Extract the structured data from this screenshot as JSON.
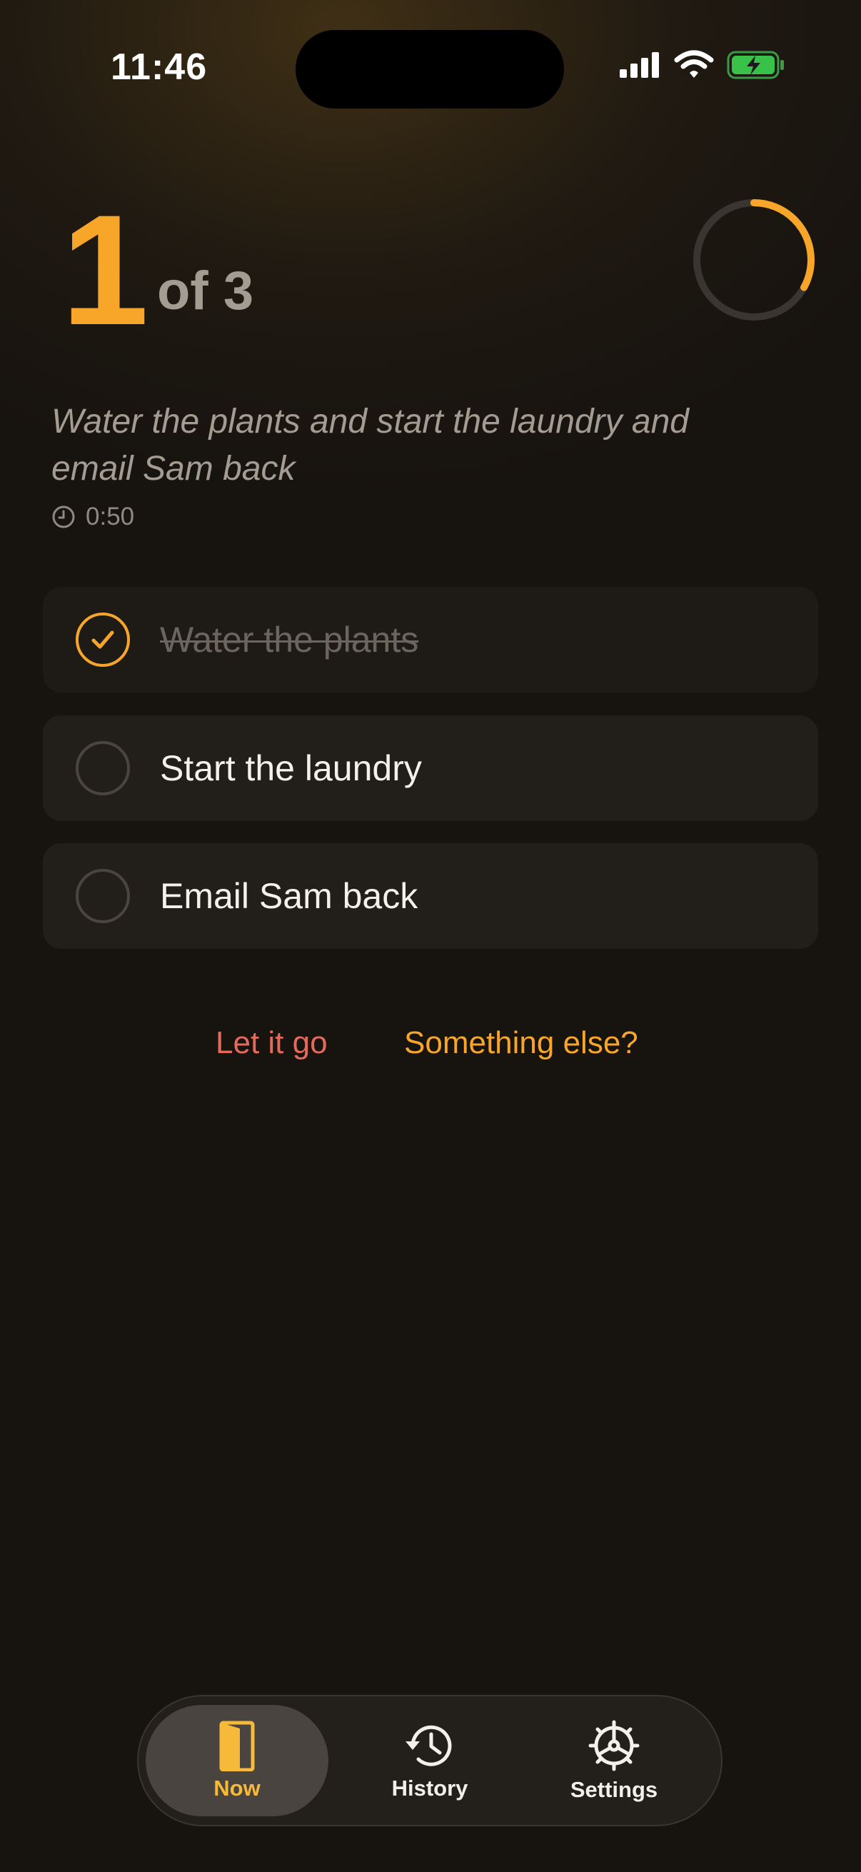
{
  "status_bar": {
    "time": "11:46"
  },
  "counter": {
    "current": "1",
    "total_label": "of 3",
    "progress": 0.33
  },
  "prompt": {
    "text": "Water the plants and start the laundry and email Sam back",
    "elapsed": "0:50"
  },
  "tasks": [
    {
      "label": "Water the plants",
      "done": true
    },
    {
      "label": "Start the laundry",
      "done": false
    },
    {
      "label": "Email Sam back",
      "done": false
    }
  ],
  "actions": {
    "let_go": "Let it go",
    "something_else": "Something else?"
  },
  "tabbar": {
    "items": [
      {
        "label": "Now",
        "icon": "door-icon",
        "active": true
      },
      {
        "label": "History",
        "icon": "history-clock-icon",
        "active": false
      },
      {
        "label": "Settings",
        "icon": "gear-icon",
        "active": false
      }
    ]
  },
  "colors": {
    "accent": "#f7a62a",
    "destructive": "#e56a5c",
    "background": "#17130f",
    "card": "#221e1a"
  }
}
